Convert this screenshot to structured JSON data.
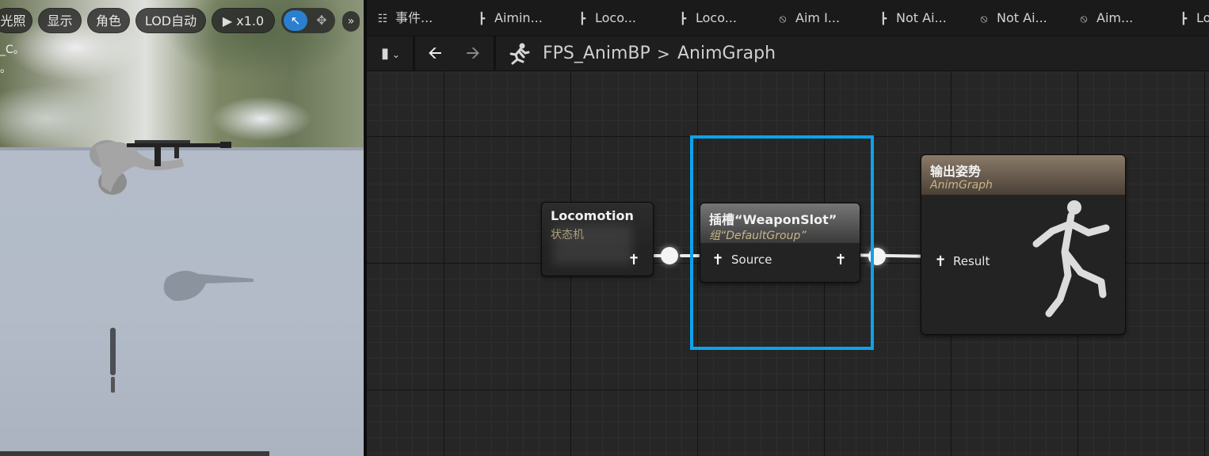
{
  "viewport": {
    "toolbar": {
      "lighting_label": "光照",
      "show_label": "显示",
      "character_label": "角色",
      "lod_label": "LOD自动",
      "play_rate_label": "x1.0"
    },
    "overlay_text_line1": "_C。",
    "overlay_text_line2": "。"
  },
  "tabs": [
    {
      "label": "事件...",
      "icon": "event-graph-icon"
    },
    {
      "label": "Aimin...",
      "icon": "state-machine-icon"
    },
    {
      "label": "Loco...",
      "icon": "state-machine-icon"
    },
    {
      "label": "Loco...",
      "icon": "state-machine-icon"
    },
    {
      "label": "Aim I...",
      "icon": "transition-icon"
    },
    {
      "label": "Not Ai...",
      "icon": "state-machine-icon"
    },
    {
      "label": "Not Ai...",
      "icon": "transition-icon"
    },
    {
      "label": "Aim...",
      "icon": "transition-icon"
    },
    {
      "label": "Lo",
      "icon": "state-machine-icon"
    }
  ],
  "breadcrumb": {
    "asset": "FPS_AnimBP",
    "separator": ">",
    "graph": "AnimGraph"
  },
  "nodes": {
    "locomotion": {
      "title": "Locomotion",
      "subtitle": "状态机"
    },
    "slot": {
      "title": "插槽“WeaponSlot”",
      "subtitle": "组“DefaultGroup”",
      "input_pin": "Source"
    },
    "output": {
      "title": "输出姿势",
      "subtitle": "AnimGraph",
      "input_pin": "Result"
    }
  },
  "colors": {
    "selection": "#0da2ec",
    "slot_header": "#6a6a6a",
    "output_header": "#7a6b5c",
    "subtitle_gold": "#c7b58a"
  }
}
